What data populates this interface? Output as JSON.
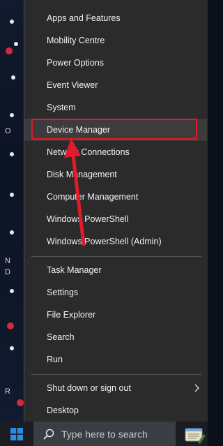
{
  "menu": {
    "group1": [
      {
        "label": "Apps and Features"
      },
      {
        "label": "Mobility Centre"
      },
      {
        "label": "Power Options"
      },
      {
        "label": "Event Viewer"
      },
      {
        "label": "System"
      },
      {
        "label": "Device Manager"
      },
      {
        "label": "Network Connections"
      },
      {
        "label": "Disk Management"
      },
      {
        "label": "Computer Management"
      },
      {
        "label": "Windows PowerShell"
      },
      {
        "label": "Windows PowerShell (Admin)"
      }
    ],
    "group2": [
      {
        "label": "Task Manager"
      },
      {
        "label": "Settings"
      },
      {
        "label": "File Explorer"
      },
      {
        "label": "Search"
      },
      {
        "label": "Run"
      }
    ],
    "group3": [
      {
        "label": "Shut down or sign out"
      },
      {
        "label": "Desktop"
      }
    ],
    "highlighted_item": "Device Manager"
  },
  "desktop": {
    "letters": [
      "O",
      "N",
      "D",
      "R"
    ]
  },
  "taskbar": {
    "search_placeholder": "Type here to search"
  },
  "colors": {
    "menu_bg": "#2b2b2b",
    "menu_text": "#f2f2f2",
    "hover_bg": "#3c3c3c",
    "annotation_red": "#e01b2b",
    "taskbar_bg": "#1b1d22",
    "search_bg": "#3a3d42",
    "windows_blue": "#2b8ce8"
  },
  "icons": {
    "start": "windows-logo-icon",
    "search": "search-icon",
    "submenu": "chevron-right-icon",
    "tray": "notepad-app-icon"
  }
}
